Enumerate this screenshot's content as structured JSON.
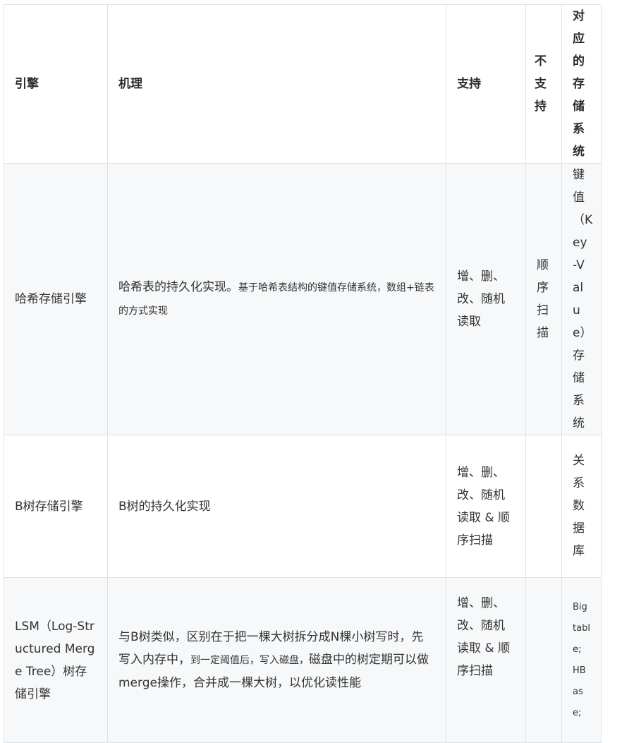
{
  "headers": [
    "引擎",
    "机理",
    "支持",
    "不支持",
    "对应的存储系统"
  ],
  "rows": [
    {
      "engine": "哈希存储引擎",
      "mechanism_main": "哈希表的持久化实现。",
      "mechanism_detail": "基于哈希表结构的键值存储系统，数组+链表的方式实现",
      "support": "增、删、改、随机读取",
      "unsupported": "顺序扫描",
      "system": "键值（Key-Value）存储系统"
    },
    {
      "engine": "B树存储引擎",
      "mechanism_main": "B树的持久化实现",
      "support": "增、删、改、随机读取 & 顺序扫描",
      "unsupported": "",
      "system": "关系数据库"
    },
    {
      "engine": "LSM（Log-Structured Merge Tree）树存储引擎",
      "mechanism_a": "与B树类似，区别在于把一棵大树拆分成N棵小树写时，先写入内存中，",
      "mechanism_b": "到一定阈值后，写入磁盘，",
      "mechanism_c": "磁盘中的树定期可以做merge操作，合并成一棵大树，以优化读性能",
      "support": "增、删、改、随机读取 & 顺序扫描",
      "unsupported": "",
      "system": "Bigtable; HBase;"
    }
  ]
}
